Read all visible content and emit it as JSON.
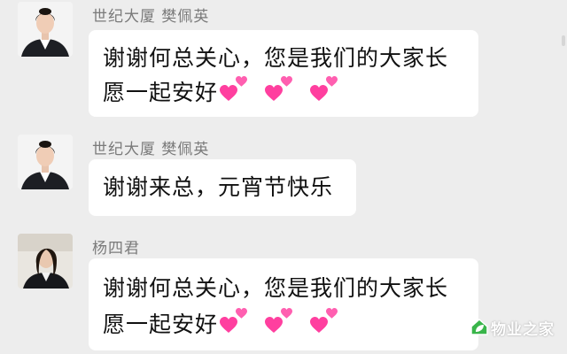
{
  "messages": [
    {
      "sender": "世纪大厦 樊佩英",
      "lines": [
        "谢谢何总关心，您是我们的大家长",
        "愿一起安好"
      ],
      "emoji": "two-hearts-icon",
      "emoji_count": 3
    },
    {
      "sender": "世纪大厦 樊佩英",
      "lines": [
        "谢谢来总，元宵节快乐"
      ]
    },
    {
      "sender": "杨四君",
      "lines": [
        "谢谢何总关心，您是我们的大家长",
        "愿一起安好"
      ],
      "emoji": "two-hearts-icon",
      "emoji_count": 3
    }
  ],
  "watermark": {
    "text": "物业之家",
    "icon": "house-leaf-icon"
  },
  "colors": {
    "background": "#ededed",
    "bubble": "#ffffff",
    "sender_name": "#7a7a7a",
    "heart": "#ff3f9f"
  }
}
